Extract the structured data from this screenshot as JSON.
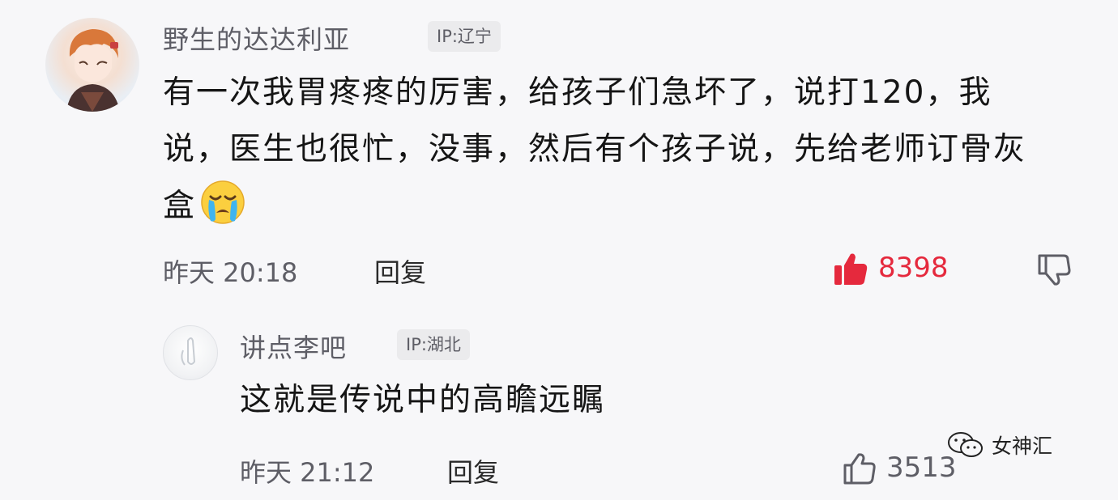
{
  "colors": {
    "background": "#f7f7f9",
    "like_active": "#e5293d",
    "meta_gray": "#5e5e66",
    "text": "#151515"
  },
  "comment": {
    "username": "野生的达达利亚",
    "ip": "IP:辽宁",
    "text": "有一次我胃疼疼的厉害，给孩子们急坏了，说打120，我说，医生也很忙，没事，然后有个孩子说，先给老师订骨灰盒",
    "emoji": "crying-face-icon",
    "time": "昨天 20:18",
    "reply_label": "回复",
    "likes": "8398",
    "liked": true
  },
  "reply": {
    "username": "讲点李吧",
    "ip": "IP:湖北",
    "text": "这就是传说中的高瞻远瞩",
    "time": "昨天 21:12",
    "reply_label": "回复",
    "likes": "3513",
    "liked": false
  },
  "watermark": {
    "text": "女神汇",
    "icon": "wechat-icon"
  }
}
